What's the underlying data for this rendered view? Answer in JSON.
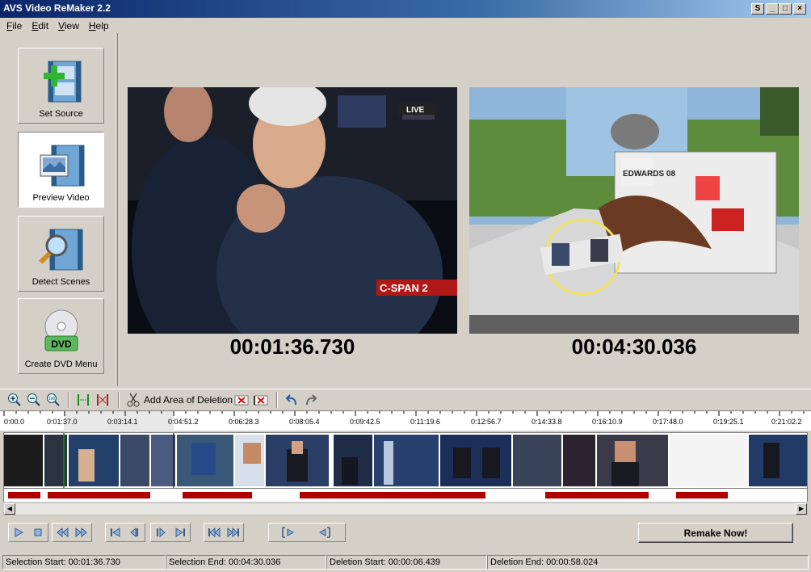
{
  "window": {
    "title": "AVS Video ReMaker 2.2"
  },
  "menu": [
    "File",
    "Edit",
    "View",
    "Help"
  ],
  "tools": [
    {
      "label": "Set Source",
      "icon": "film-add-icon"
    },
    {
      "label": "Preview Video",
      "icon": "film-preview-icon"
    },
    {
      "label": "Detect Scenes",
      "icon": "film-magnifier-icon"
    },
    {
      "label": "Create DVD Menu",
      "icon": "dvd-disc-icon"
    }
  ],
  "preview": {
    "left_timecode": "00:01:36.730",
    "right_timecode": "00:04:30.036",
    "left_badge_live": "LIVE",
    "left_badge_channel": "C-SPAN 2",
    "right_sign": "EDWARDS 08"
  },
  "toolbar": {
    "add_area_label": "Add Area of Deletion"
  },
  "ruler": {
    "ticks": [
      "0:00.0",
      "0:01:37.0",
      "0:03:14.1",
      "0:04:51.2",
      "0:06:28.3",
      "0:08:05.4",
      "0:09:42.5",
      "0:11:19.6",
      "0:12:56.7",
      "0:14:33.8",
      "0:16:10.9",
      "0:17:48.0",
      "0:19:25.1",
      "0:21:02.2"
    ]
  },
  "actions": {
    "remake_label": "Remake Now!"
  },
  "status": {
    "selection_start": "Selection Start: 00:01:36.730",
    "selection_end": "Selection End: 00:04:30.036",
    "deletion_start": "Deletion Start: 00:00:06.439",
    "deletion_end": "Deletion End: 00:00:58.024"
  },
  "colors": {
    "deletion": "#b00000",
    "title_gradient_start": "#0a246a"
  }
}
